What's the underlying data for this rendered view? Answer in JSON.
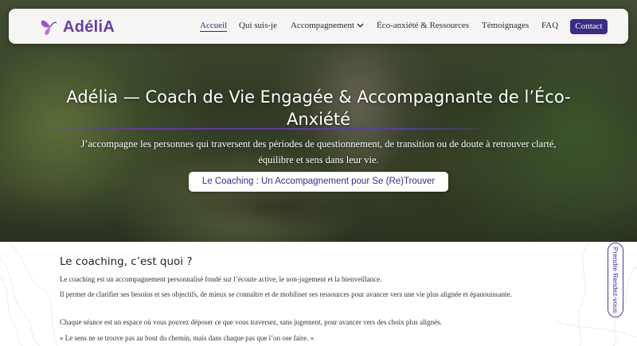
{
  "brand": {
    "name": "AdéliA",
    "logo_icon": "butterfly-icon",
    "color": "#6b3aa8"
  },
  "nav": {
    "items": [
      {
        "label": "Accueil",
        "active": true
      },
      {
        "label": "Qui suis-je"
      },
      {
        "label": "Accompagnement",
        "dropdown": true
      },
      {
        "label": "Éco-anxiété & Ressources"
      },
      {
        "label": "Témoignages"
      },
      {
        "label": "FAQ"
      }
    ],
    "contact_label": "Contact"
  },
  "hero": {
    "title": "Adélia — Coach de Vie Engagée & Accompagnante de l’Éco-Anxiété",
    "subtitle": "J’accompagne les personnes qui traversent des périodes de questionnement, de transition ou de doute à retrouver clarté, équilibre et sens dans leur vie.",
    "cta_label": "Le Coaching : Un Accompagnement pour Se (Re)Trouver"
  },
  "section": {
    "title": "Le coaching, c’est quoi ?",
    "paragraphs": [
      "Le coaching est un accompagnement personnalisé fondé sur l’écoute active, le non-jugement et la bienveillance.",
      "Il permet de clarifier ses besoins et ses objectifs, de mieux se connaître et de mobiliser ses ressources pour avancer vers une vie plus alignée et épanouissante.",
      "Chaque séance est un espace où vous pouvez déposer ce que vous traversez, sans jugement, pour avancer vers des choix plus alignés.",
      "« Le sens ne se trouve pas au bout du chemin, mais dans chaque pas que l’on ose faire. »"
    ]
  },
  "side_tab": {
    "label": "Prendre Rendez-vous"
  },
  "colors": {
    "accent": "#3b2a87",
    "brand": "#6b3aa8"
  }
}
